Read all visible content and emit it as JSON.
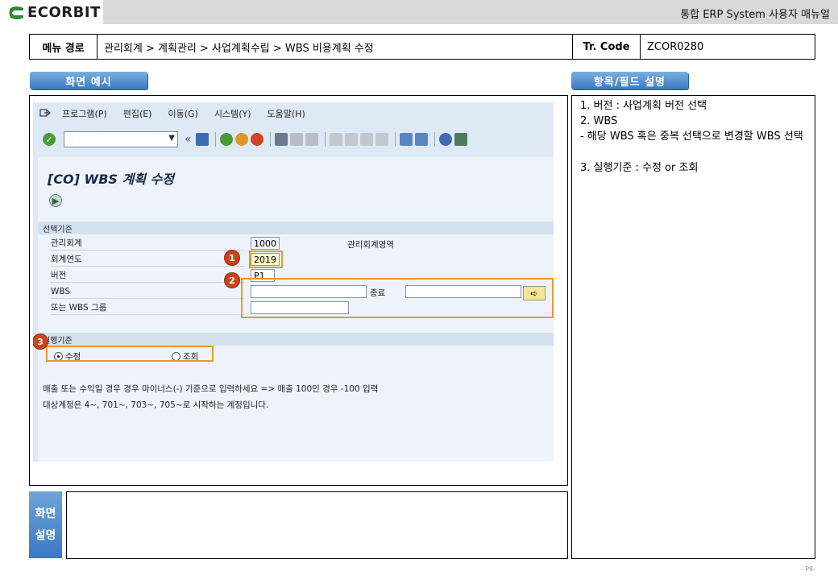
{
  "header": {
    "logo_text": "ECORBIT",
    "title": "통합 ERP System 사용자 매뉴얼"
  },
  "path_row": {
    "menu_label": "메뉴 경로",
    "menu_path": "관리회계 > 계획관리 > 사업계획수립 > WBS 비용계획 수정",
    "tr_label": "Tr. Code",
    "tr_value": "ZCOR0280"
  },
  "sections": {
    "screen_example": "화면 예시",
    "field_desc": "항목/필드 설명",
    "screen_desc": "화면 설명"
  },
  "sap": {
    "menu": [
      "프로그램(P)",
      "편집(E)",
      "이동(G)",
      "시스템(Y)",
      "도움말(H)"
    ],
    "menu_icon": "exit-menu-icon",
    "title": "[CO] WBS 계획 수정",
    "group1_title": "선택기준",
    "fields": {
      "ctrl_area_label": "관리회계",
      "ctrl_area_value": "1000",
      "ctrl_area_text": "관리회계영역",
      "fiscal_year_label": "회계연도",
      "fiscal_year_value": "2019",
      "version_label": "버전",
      "version_value": "P1",
      "wbs_label": "WBS",
      "wbs_to_label": "종료",
      "wbs_group_label": "또는 WBS 그룹"
    },
    "group2_title": "실행기준",
    "radio_edit": "수정",
    "radio_view": "조회",
    "radio_selected": "수정",
    "note1": "매출 또는 수익일 경우 경우 마이너스(-) 기준으로 입력하세요 => 매출 100인 경우 -100 입력",
    "note2": "대상계정은 4~, 701~, 703~, 705~로 시작하는 계정입니다.",
    "badges": [
      "1",
      "2",
      "3"
    ],
    "highlight_color": "#e89a2a"
  },
  "description": {
    "item1": "1.  버전 : 사업계획 버전 선택",
    "item2": "2.  WBS",
    "item2_detail": "  - 해당 WBS 혹은 중복 선택으로 변경할 WBS 선택",
    "item3": "3. 실행기준 : 수정 or 조회"
  },
  "bottom_label_line1": "화면",
  "bottom_label_line2": "설명",
  "page_number": "- P8-",
  "colors": {
    "tab_blue": "#3b78c2",
    "badge_red": "#c9431b",
    "logo_green": "#2e8b3a"
  }
}
